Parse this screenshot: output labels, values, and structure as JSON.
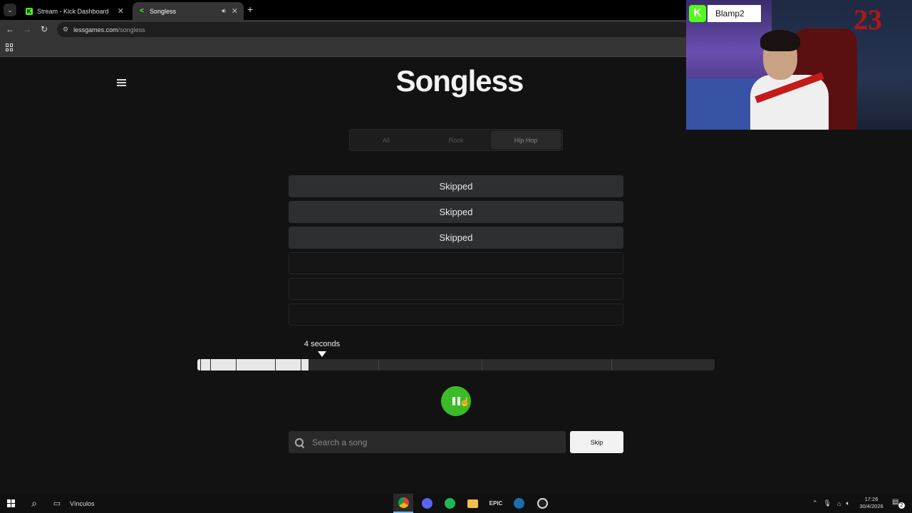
{
  "browser": {
    "tabs": [
      {
        "title": "Stream - Kick Dashboard",
        "favicon": "kick-icon",
        "active": false
      },
      {
        "title": "Songless",
        "favicon": "songless-icon",
        "active": true,
        "audio": true
      }
    ],
    "address": {
      "host": "lessgames.com",
      "path": "/songless"
    }
  },
  "page": {
    "logo": "Songless",
    "genres": [
      {
        "label": "All",
        "active": false
      },
      {
        "label": "Rock",
        "active": false
      },
      {
        "label": "Hip Hop",
        "active": true
      }
    ],
    "guesses": [
      "Skipped",
      "Skipped",
      "Skipped",
      "",
      "",
      ""
    ],
    "timeline": {
      "label": "4 seconds",
      "played_fraction": 0.215,
      "segment_boundaries_seconds": [
        0.1,
        0.5,
        1.5,
        3,
        4,
        7,
        11,
        16
      ],
      "total_seconds": 20
    },
    "play_state": "playing",
    "search": {
      "placeholder": "Search a song",
      "value": ""
    },
    "skip_label": "Skip"
  },
  "webcam": {
    "streamer_name": "Blamp2",
    "platform_badge": "K",
    "decor_text": "23"
  },
  "taskbar": {
    "links_label": "Vínculos",
    "apps": [
      "chrome-icon",
      "discord-icon",
      "spotify-icon",
      "file-explorer-icon",
      "epic-games-icon",
      "steam-icon",
      "obs-icon"
    ],
    "time": "17:26",
    "date": "30/4/2026",
    "notification_count": "2"
  },
  "colors": {
    "accent_green": "#3bbb27",
    "kick_green": "#53fc18",
    "background": "#121212"
  }
}
